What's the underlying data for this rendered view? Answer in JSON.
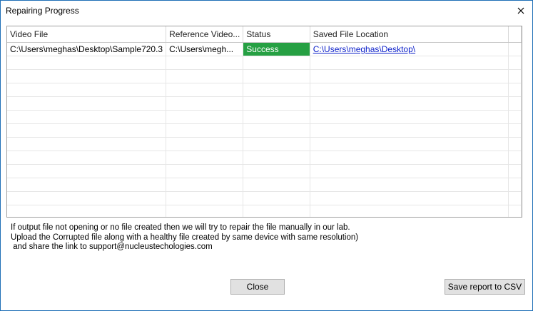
{
  "window": {
    "title": "Repairing Progress"
  },
  "table": {
    "columns": [
      "Video File",
      "Reference Video...",
      "Status",
      "Saved File Location",
      ""
    ],
    "rows": [
      {
        "video_file": "C:\\Users\\meghas\\Desktop\\Sample720.3",
        "reference_video": "C:\\Users\\megh...",
        "status": "Success",
        "saved_location": "C:\\Users\\meghas\\Desktop\\"
      }
    ],
    "status_color": "#26a043"
  },
  "info": {
    "line1": "If output file not opening or no file created then we will try to repair the file manually in our lab.",
    "line2": "Upload the Corrupted file along with a healthy file created by same device with same resolution)",
    "line3": " and share the link to support@nucleustechologies.com"
  },
  "buttons": {
    "close": "Close",
    "save_csv": "Save report to CSV"
  }
}
